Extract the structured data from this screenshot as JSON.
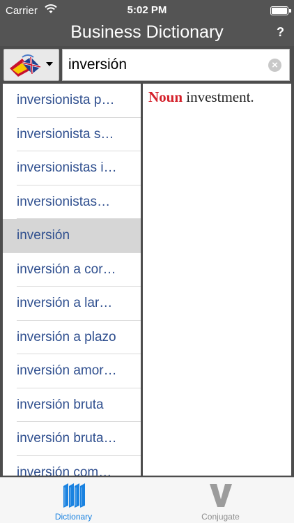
{
  "status_bar": {
    "carrier": "Carrier",
    "time": "5:02 PM"
  },
  "nav_bar": {
    "title": "Business Dictionary",
    "help_label": "?"
  },
  "search": {
    "value": "inversión",
    "language_icon": "spain-uk-flags-icon"
  },
  "word_list": {
    "items": [
      "inversionista p…",
      "inversionista s…",
      "inversionistas i…",
      "inversionistas…",
      "inversión",
      "inversión a cor…",
      "inversión a lar…",
      "inversión a plazo",
      "inversión amor…",
      "inversión bruta",
      "inversión bruta…",
      "inversión com…"
    ],
    "selected_index": 4
  },
  "definition": {
    "part_of_speech": "Noun",
    "text": " investment."
  },
  "tab_bar": {
    "tabs": [
      {
        "label": "Dictionary",
        "icon": "books-icon",
        "active": true
      },
      {
        "label": "Conjugate",
        "icon": "v-letter-icon",
        "active": false
      }
    ]
  },
  "colors": {
    "bar_background": "#545454",
    "link_blue": "#2e4e8e",
    "active_tab": "#1a82e0",
    "part_of_speech": "#d4202a"
  }
}
